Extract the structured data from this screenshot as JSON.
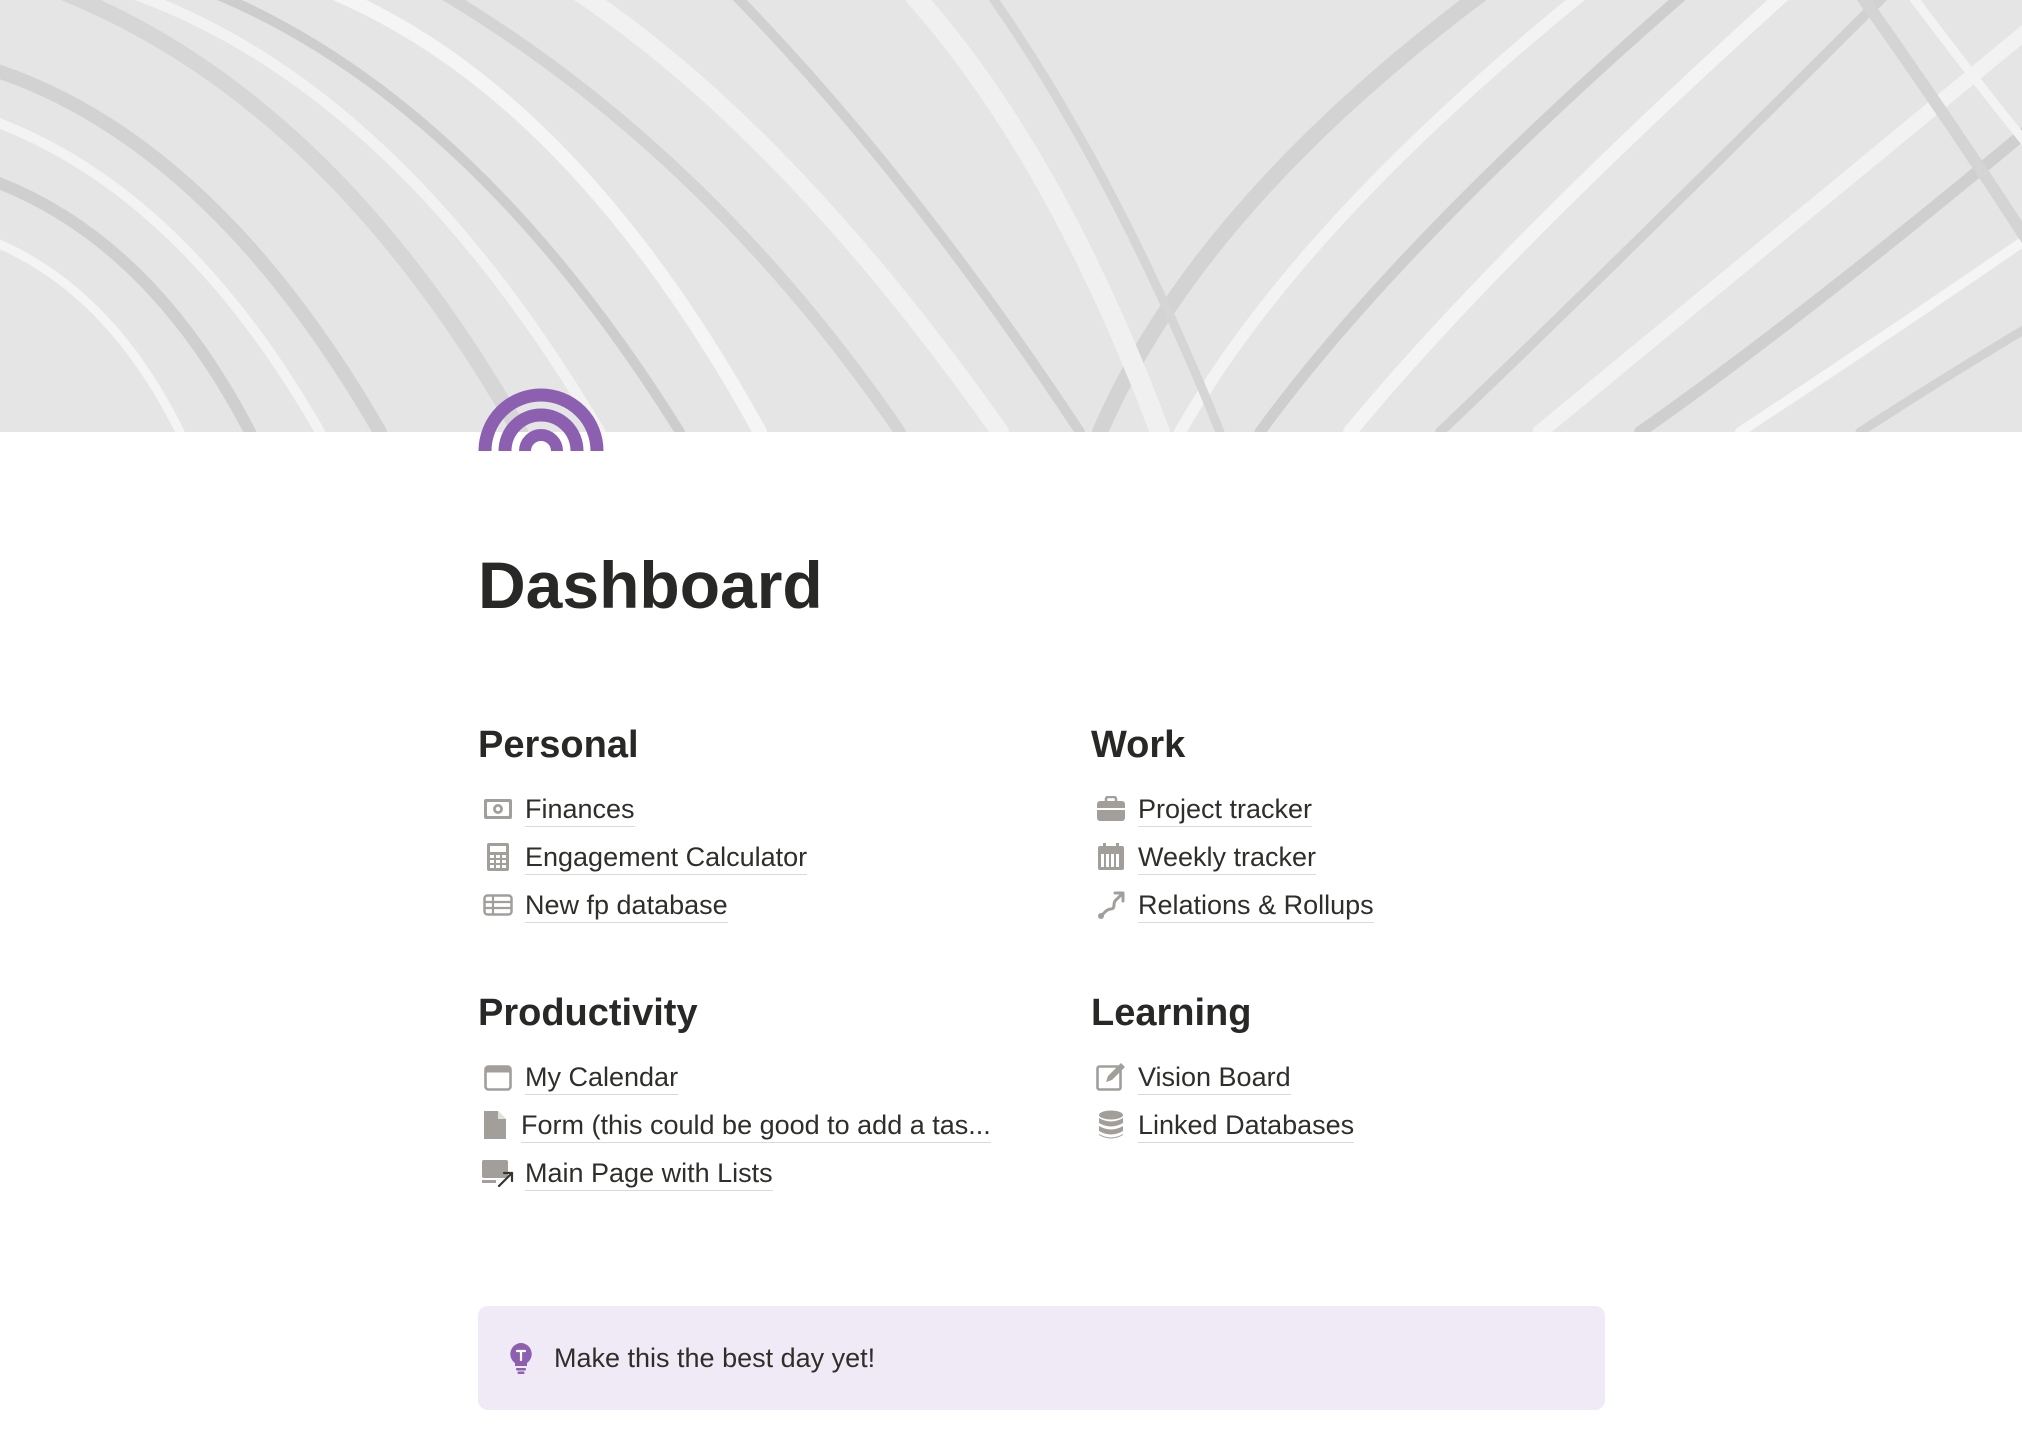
{
  "page": {
    "title": "Dashboard",
    "icon": "rainbow-arc-icon",
    "cover": "white-plaster-texture"
  },
  "colors": {
    "accent_purple": "#8d5fb0",
    "callout_background": "#f0eaf6",
    "icon_gray": "#a29f9a",
    "text": "#2f2e2b"
  },
  "sections": {
    "personal": {
      "heading": "Personal",
      "links": [
        {
          "label": "Finances",
          "icon": "money-bill-icon"
        },
        {
          "label": "Engagement Calculator",
          "icon": "calculator-icon"
        },
        {
          "label": "New fp database",
          "icon": "table-icon"
        }
      ]
    },
    "work": {
      "heading": "Work",
      "links": [
        {
          "label": "Project tracker",
          "icon": "briefcase-icon"
        },
        {
          "label": "Weekly tracker",
          "icon": "calendar-week-icon"
        },
        {
          "label": "Relations & Rollups",
          "icon": "relation-arrow-icon"
        }
      ]
    },
    "productivity": {
      "heading": "Productivity",
      "links": [
        {
          "label": "My Calendar",
          "icon": "calendar-icon"
        },
        {
          "label": "Form (this could be good to add a tas...",
          "icon": "document-icon"
        },
        {
          "label": "Main Page with Lists",
          "icon": "linked-page-icon"
        }
      ]
    },
    "learning": {
      "heading": "Learning",
      "links": [
        {
          "label": "Vision Board",
          "icon": "edit-board-icon"
        },
        {
          "label": "Linked Databases",
          "icon": "database-icon"
        }
      ]
    }
  },
  "callout": {
    "icon": "lightbulb-icon",
    "text": "Make this the best day yet!"
  }
}
